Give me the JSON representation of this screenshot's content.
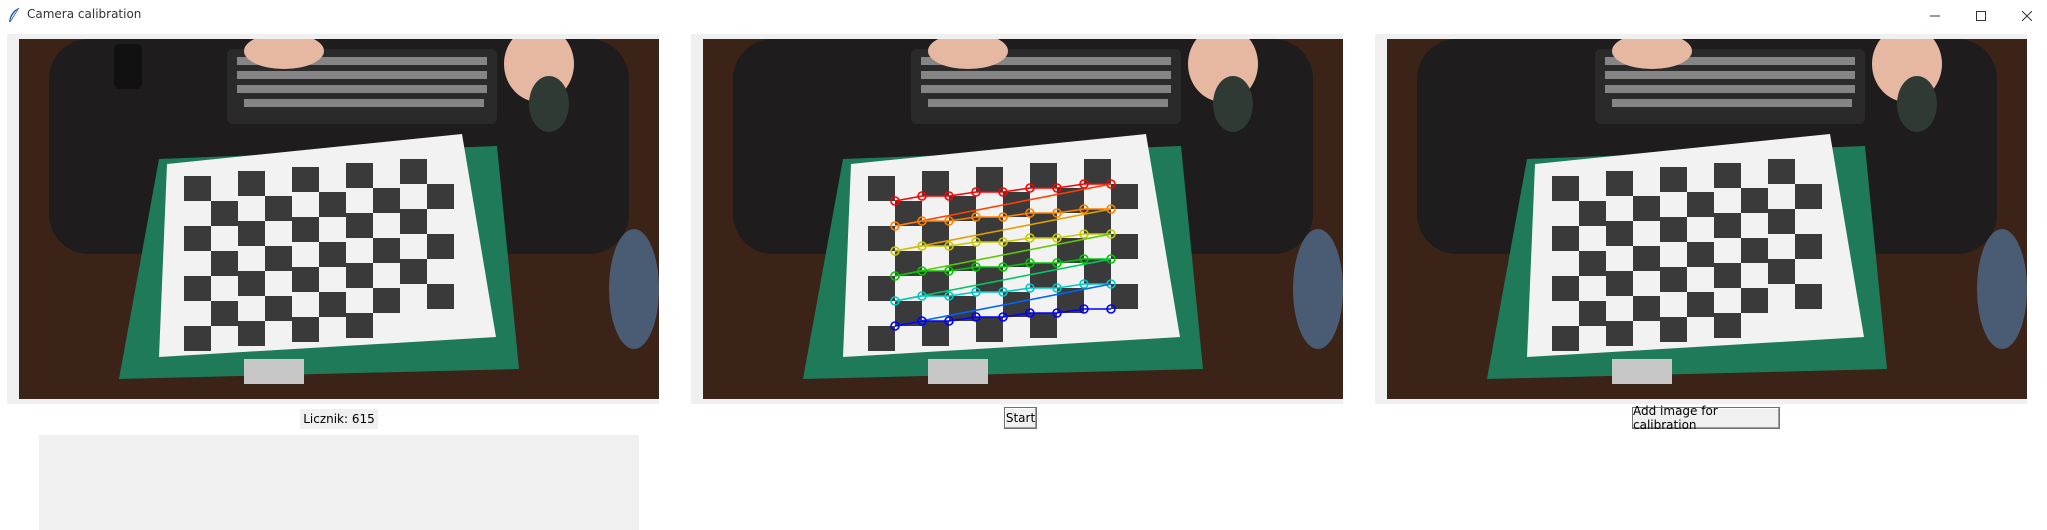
{
  "window": {
    "title": "Camera calibration",
    "icon": "feather-icon",
    "controls": [
      "minimize-icon",
      "maximize-icon",
      "close-icon"
    ]
  },
  "panels": {
    "left": {
      "image": "webcam-raw-feed",
      "content": "desk with keyboard, hands, mouse and printed chessboard"
    },
    "center": {
      "image": "webcam-detected-corners",
      "content": "chessboard with colored corner markers (red, orange, yellow, green, cyan, blue rows)"
    },
    "right": {
      "image": "webcam-undistorted-feed",
      "content": "desk with keyboard, hands, mouse and printed chessboard"
    }
  },
  "counter": {
    "label": "Licznik: 615"
  },
  "buttons": {
    "start": "Start",
    "add_image": "Add image for calibration"
  },
  "colors": {
    "desk": "#1e1c1c",
    "wood": "#3a2418",
    "mat": "#1f7a5a",
    "paper": "#f2f2f2",
    "square": "#3a3a3a",
    "panel_bg": "#f0f0f0"
  },
  "corner_rows": [
    "#ff0000",
    "#ff8000",
    "#c8c800",
    "#00c800",
    "#00c8c8",
    "#0000ff"
  ]
}
